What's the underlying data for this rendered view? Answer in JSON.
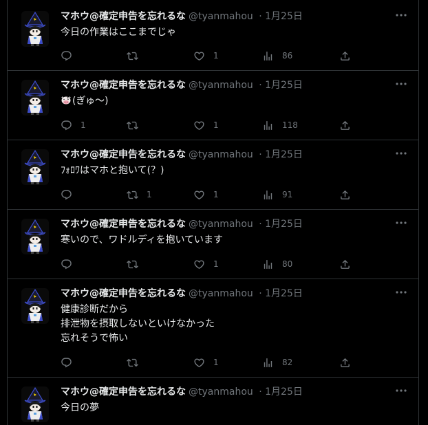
{
  "tweets": [
    {
      "name": "マホウ@確定申告を忘れるな",
      "handle": "@tyanmahou",
      "sep": "·",
      "date": "1月25日",
      "text": "今日の作業はここまでじゃ",
      "replies": "",
      "retweets": "",
      "likes": "1",
      "views": "86"
    },
    {
      "name": "マホウ@確定申告を忘れるな",
      "handle": "@tyanmahou",
      "sep": "·",
      "date": "1月25日",
      "emoji": "cow-face",
      "text": "(ぎゅ〜)",
      "replies": "1",
      "retweets": "",
      "likes": "1",
      "views": "118"
    },
    {
      "name": "マホウ@確定申告を忘れるな",
      "handle": "@tyanmahou",
      "sep": "·",
      "date": "1月25日",
      "text": "ﾌｫﾛﾜはマホと抱いて(？)",
      "replies": "",
      "retweets": "1",
      "likes": "1",
      "views": "91"
    },
    {
      "name": "マホウ@確定申告を忘れるな",
      "handle": "@tyanmahou",
      "sep": "·",
      "date": "1月25日",
      "text": "寒いので、ワドルディを抱いています",
      "replies": "",
      "retweets": "",
      "likes": "1",
      "views": "80"
    },
    {
      "name": "マホウ@確定申告を忘れるな",
      "handle": "@tyanmahou",
      "sep": "·",
      "date": "1月25日",
      "text": "健康診断だから\n排泄物を摂取しないといけなかった\n忘れそうで怖い",
      "replies": "",
      "retweets": "",
      "likes": "1",
      "views": "82"
    },
    {
      "name": "マホウ@確定申告を忘れるな",
      "handle": "@tyanmahou",
      "sep": "·",
      "date": "1月25日",
      "text": "今日の夢"
    }
  ],
  "icons": {
    "reply": "reply-icon",
    "retweet": "retweet-icon",
    "like": "heart-icon",
    "views": "views-icon",
    "share": "share-icon",
    "more": "more-icon"
  },
  "colors": {
    "background": "#000000",
    "text": "#e7e9ea",
    "muted": "#71767b",
    "border": "#2f3336"
  }
}
